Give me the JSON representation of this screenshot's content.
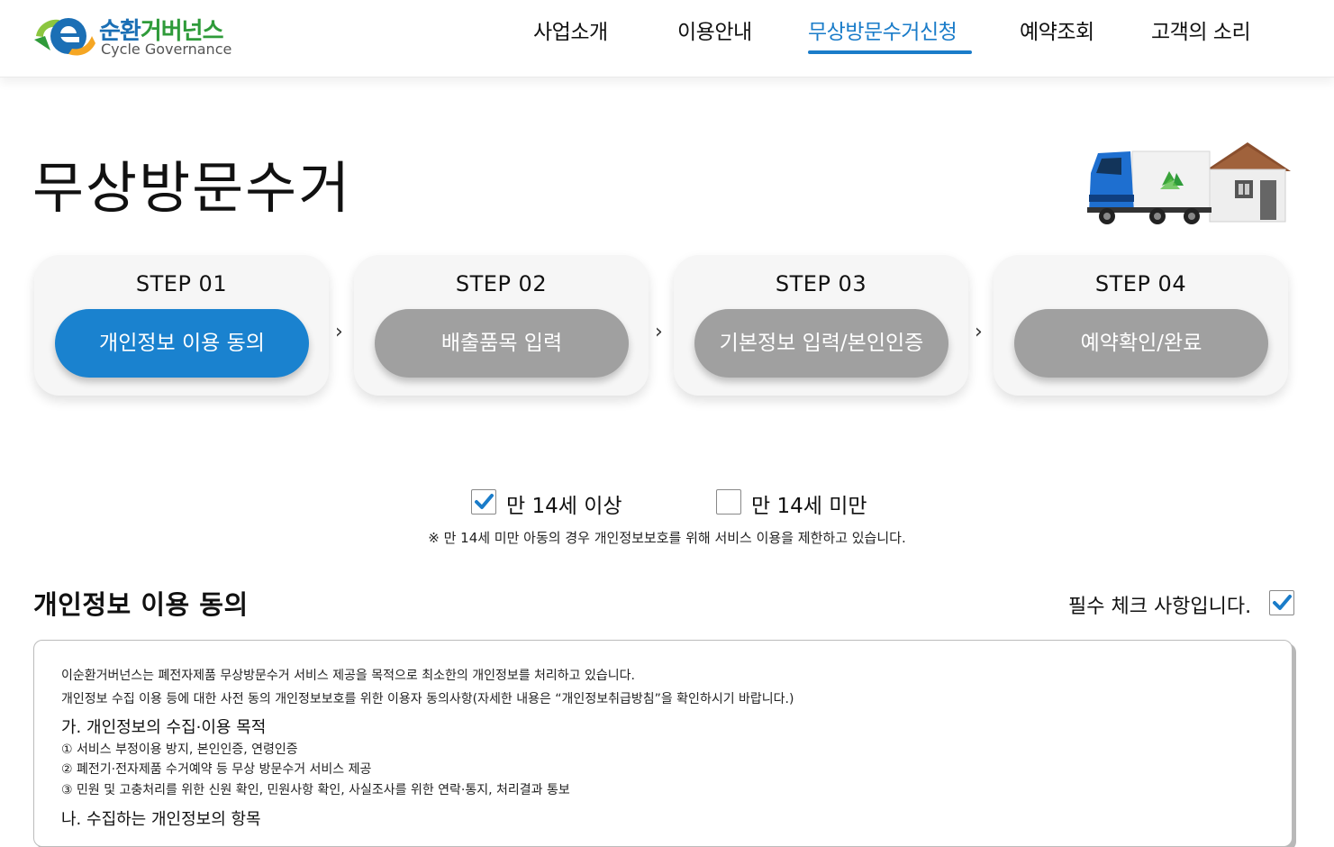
{
  "brand": {
    "title_blue": "순환",
    "title_green": "거버넌스",
    "subtitle": "Cycle Governance"
  },
  "nav": {
    "items": [
      "사업소개",
      "이용안내",
      "무상방문수거신청",
      "예약조회",
      "고객의 소리"
    ],
    "active_index": 2
  },
  "page": {
    "title": "무상방문수거"
  },
  "steps": [
    {
      "label": "STEP 01",
      "button": "개인정보 이용 동의",
      "active": true
    },
    {
      "label": "STEP 02",
      "button": "배출품목 입력",
      "active": false
    },
    {
      "label": "STEP 03",
      "button": "기본정보 입력/본인인증",
      "active": false
    },
    {
      "label": "STEP 04",
      "button": "예약확인/완료",
      "active": false
    }
  ],
  "step_separator": "›",
  "age": {
    "over14": {
      "label": "만 14세 이상",
      "checked": true
    },
    "under14": {
      "label": "만 14세 미만",
      "checked": false
    },
    "note": "※ 만 14세 미만 아동의 경우 개인정보보호를 위해 서비스 이용을 제한하고 있습니다."
  },
  "consent": {
    "title": "개인정보 이용 동의",
    "required_label": "필수 체크 사항입니다.",
    "required_checked": true,
    "intro_lines": [
      "이순환거버넌스는 폐전자제품 무상방문수거 서비스 제공을 목적으로 최소한의 개인정보를 처리하고 있습니다.",
      "개인정보 수집 이용 등에 대한 사전 동의 개인정보보호를 위한 이용자 동의사항(자세한 내용은 “개인정보취급방침”을 확인하시기 바랍니다.)"
    ],
    "section_a": {
      "heading": "가. 개인정보의 수집·이용 목적",
      "items": [
        "① 서비스 부정이용 방지, 본인인증, 연령인증",
        "② 폐전기·전자제품 수거예약 등 무상 방문수거 서비스 제공",
        "③ 민원 및 고충처리를 위한 신원 확인, 민원사항 확인, 사실조사를 위한 연락·통지, 처리결과 통보"
      ]
    },
    "section_b": {
      "heading": "나. 수집하는 개인정보의 항목"
    }
  },
  "colors": {
    "accent": "#1a7cc9",
    "step_active": "#1a82cf",
    "step_inactive": "#a0a0a0",
    "brand_green": "#2f9b3a"
  },
  "icons": {
    "logo": "e-recycle-logo",
    "hero": "recycle-truck-house-illustration",
    "check": "checkmark-icon"
  }
}
